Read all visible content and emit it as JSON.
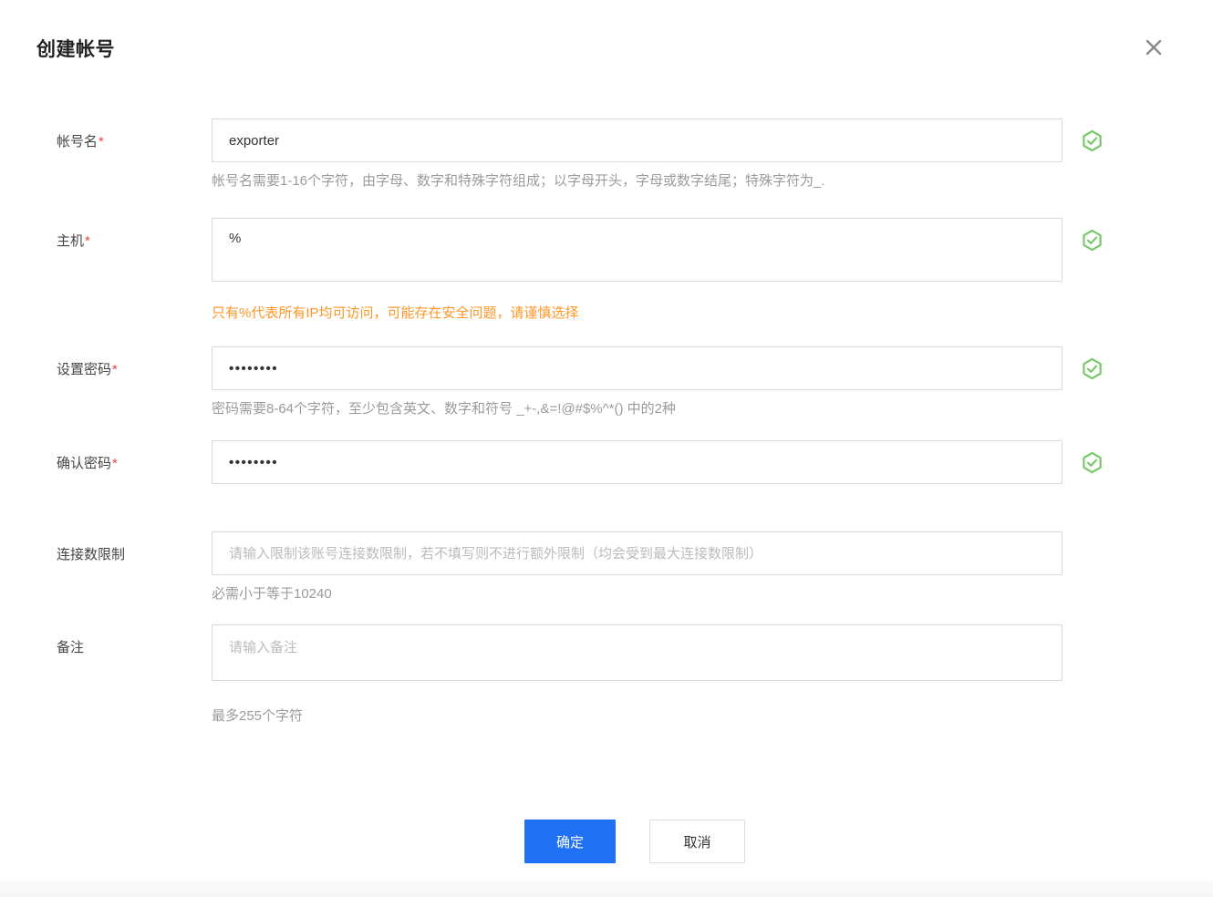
{
  "dialog": {
    "title": "创建帐号"
  },
  "form": {
    "required_marker": "*",
    "fields": [
      {
        "label": "帐号名",
        "required": true,
        "value": "exporter",
        "valid": true,
        "hint": "帐号名需要1-16个字符，由字母、数字和特殊字符组成；以字母开头，字母或数字结尾；特殊字符为_."
      },
      {
        "label": "主机",
        "required": true,
        "value": "%",
        "valid": true,
        "warning": "只有%代表所有IP均可访问，可能存在安全问题，请谨慎选择"
      },
      {
        "label": "设置密码",
        "required": true,
        "value_masked": "••••••••",
        "valid": true,
        "hint": "密码需要8-64个字符，至少包含英文、数字和符号 _+-,&=!@#$%^*() 中的2种"
      },
      {
        "label": "确认密码",
        "required": true,
        "value_masked": "••••••••",
        "valid": true
      },
      {
        "label": "连接数限制",
        "required": false,
        "value": "",
        "placeholder": "请输入限制该账号连接数限制，若不填写则不进行额外限制（均会受到最大连接数限制）",
        "hint": "必需小于等于10240"
      },
      {
        "label": "备注",
        "required": false,
        "value": "",
        "placeholder": "请输入备注",
        "hint": "最多255个字符"
      }
    ]
  },
  "footer": {
    "confirm_label": "确定",
    "cancel_label": "取消"
  },
  "icons": {
    "close": "close-x-icon",
    "valid": "success-check-hexagon-icon"
  },
  "colors": {
    "primary_blue": "#2070f3",
    "warning_orange": "#ff9626",
    "success_green": "#74c865",
    "required_red": "#e54545"
  }
}
